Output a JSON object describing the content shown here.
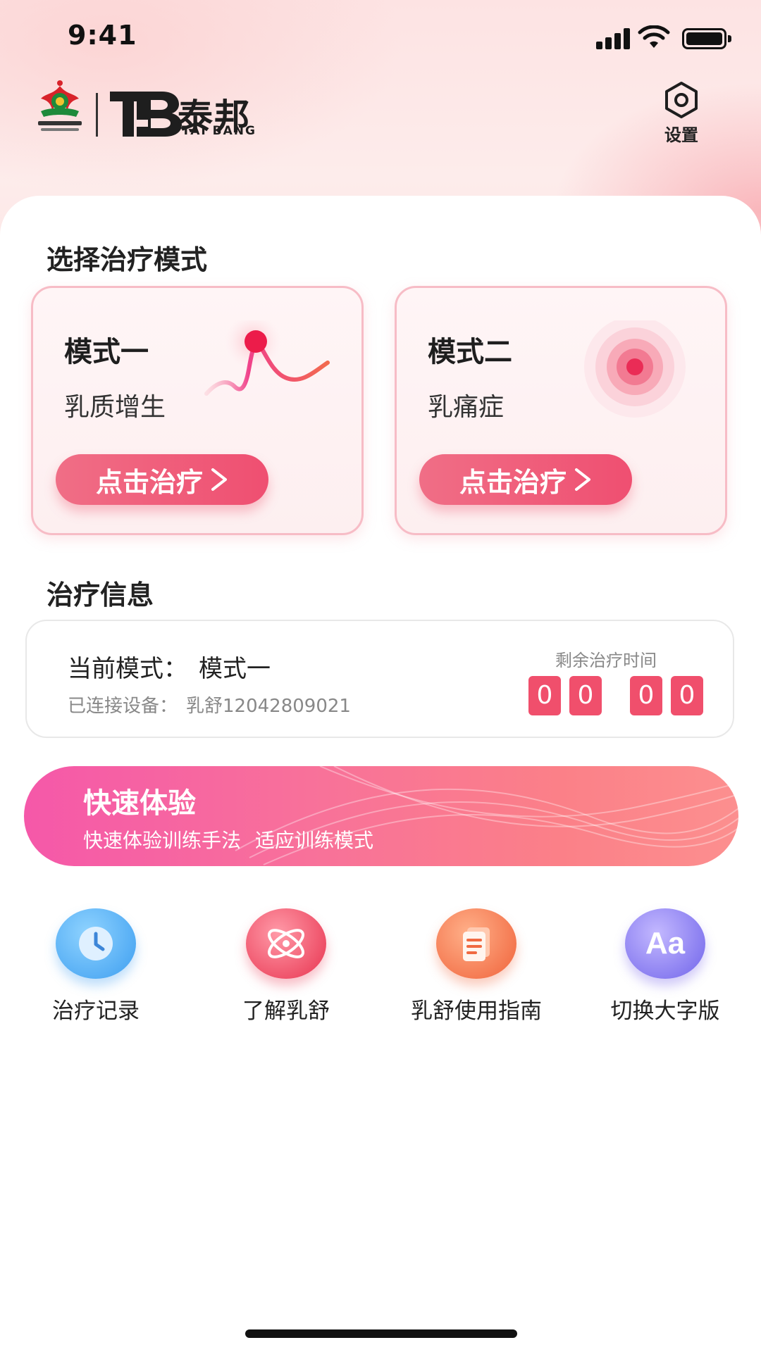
{
  "status_bar": {
    "time": "9:41"
  },
  "header": {
    "logo_brand_cn": "泰邦",
    "logo_brand_en": "TAI BANG",
    "settings_label": "设置"
  },
  "mode_section": {
    "title": "选择治疗模式",
    "modes": [
      {
        "name": "模式一",
        "desc": "乳质增生",
        "button": "点击治疗"
      },
      {
        "name": "模式二",
        "desc": "乳痛症",
        "button": "点击治疗"
      }
    ]
  },
  "info_section": {
    "title": "治疗信息",
    "current_mode_label": "当前模式：",
    "current_mode_value": "模式一",
    "device_label": "已连接设备：",
    "device_value": "乳舒12042809021",
    "remaining_label": "剩余治疗时间",
    "timer_digits": [
      "0",
      "0",
      "0",
      "0"
    ],
    "timer_separator": ":"
  },
  "quick_banner": {
    "title": "快速体验",
    "subtitle_a": "快速体验训练手法",
    "subtitle_b": "适应训练模式"
  },
  "functions": [
    {
      "label": "治疗记录",
      "icon": "clock-icon",
      "color": "#4fb0f2"
    },
    {
      "label": "了解乳舒",
      "icon": "atom-icon",
      "color": "#f0526b"
    },
    {
      "label": "乳舒使用指南",
      "icon": "document-icon",
      "color": "#f7855e"
    },
    {
      "label": "切换大字版",
      "icon": "font-size-icon",
      "color": "#8b82f2"
    }
  ],
  "colors": {
    "accent": "#f04f6c",
    "card_border": "#f7bcc6"
  }
}
